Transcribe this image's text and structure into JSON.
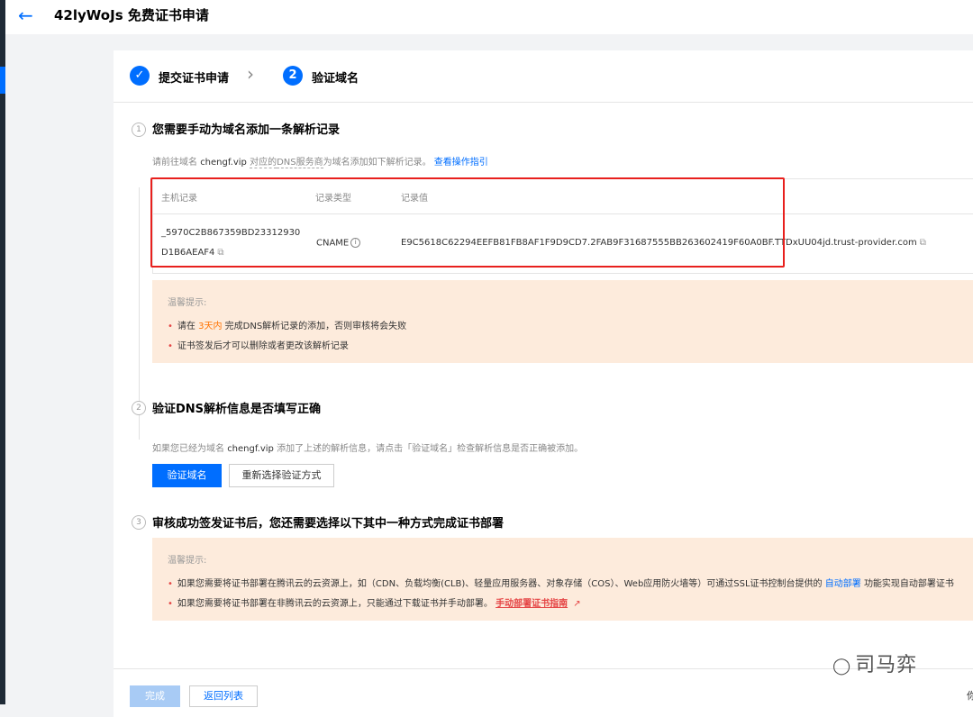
{
  "header": {
    "title": "42lyWoJs 免费证书申请"
  },
  "steps": [
    {
      "number": "",
      "label": "提交证书申请"
    },
    {
      "number": "2",
      "label": "验证域名"
    }
  ],
  "section1": {
    "num": "1",
    "title": "您需要手动为域名添加一条解析记录",
    "desc_prefix": "请前往域名",
    "domain": "chengf.vip",
    "desc_mid1": "对应的",
    "desc_mid2": "DNS服务商",
    "desc_suffix": "为域名添加如下解析记录。",
    "guide_link": "查看操作指引"
  },
  "table": {
    "columns": [
      "主机记录",
      "记录类型",
      "记录值"
    ],
    "row": {
      "host_line1": "_5970C2B867359BD23312930",
      "host_line2": "D1B6AEAF4",
      "type": "CNAME",
      "value": "E9C5618C62294EEFB81FB8AF1F9D9CD7.2FAB9F31687555BB263602419F60A0BF.TTDxUU04jd.trust-provider.com"
    }
  },
  "tip1": {
    "title": "温馨提示:",
    "item1_pre": "请在",
    "item1_highlight": "3天内",
    "item1_post": "完成DNS解析记录的添加，否则审核将会失败",
    "item2": "证书签发后才可以删除或者更改该解析记录"
  },
  "section2": {
    "num": "2",
    "title": "验证DNS解析信息是否填写正确",
    "desc_prefix": "如果您已经为域名",
    "domain": "chengf.vip",
    "desc_suffix": "添加了上述的解析信息，请点击「验证域名」检查解析信息是否正确被添加。",
    "verify_button": "验证域名",
    "reselect_button": "重新选择验证方式"
  },
  "section3": {
    "num": "3",
    "title": "审核成功签发证书后，您还需要选择以下其中一种方式完成证书部署"
  },
  "tip2": {
    "title": "温馨提示:",
    "item1_pre": "如果您需要将证书部署在腾讯云的云资源上，如（CDN、负载均衡(CLB)、轻量应用服务器、对象存储（COS）、Web应用防火墙等）可通过SSL证书控制台提供的",
    "item1_link": "自动部署",
    "item1_post": "功能实现自动部署证书",
    "item2_pre": "如果您需要将证书部署在非腾讯云的云资源上，只能通过下载证书并手动部署。",
    "item2_link": "手动部署证书指南"
  },
  "footer": {
    "done_button": "完成",
    "back_button": "返回列表",
    "cut_text": "你"
  },
  "watermark": "司马弈"
}
